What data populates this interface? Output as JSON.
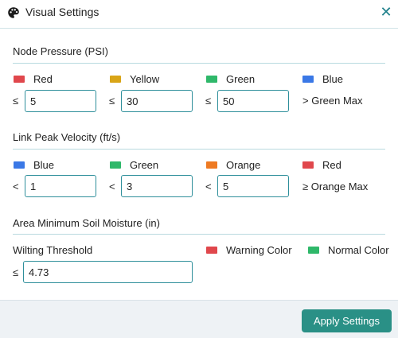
{
  "header": {
    "title": "Visual Settings",
    "icon": "palette-icon",
    "close_icon": "close-icon",
    "close_glyph": "✕"
  },
  "node_pressure": {
    "title": "Node Pressure (PSI)",
    "items": [
      {
        "label": "Red",
        "color": "#e0474c",
        "operator": "≤",
        "value": "5"
      },
      {
        "label": "Yellow",
        "color": "#d9a517",
        "operator": "≤",
        "value": "30"
      },
      {
        "label": "Green",
        "color": "#2fb86a",
        "operator": "≤",
        "value": "50"
      },
      {
        "label": "Blue",
        "color": "#3a78e6",
        "note": "> Green Max"
      }
    ]
  },
  "link_velocity": {
    "title": "Link Peak Velocity (ft/s)",
    "items": [
      {
        "label": "Blue",
        "color": "#3a78e6",
        "operator": "<",
        "value": "1"
      },
      {
        "label": "Green",
        "color": "#2fb86a",
        "operator": "<",
        "value": "3"
      },
      {
        "label": "Orange",
        "color": "#ee7a22",
        "operator": "<",
        "value": "5"
      },
      {
        "label": "Red",
        "color": "#e0474c",
        "note": "≥ Orange Max"
      }
    ]
  },
  "soil_moisture": {
    "title": "Area Minimum Soil Moisture (in)",
    "threshold_label": "Wilting Threshold",
    "operator": "≤",
    "value": "4.73",
    "warning": {
      "label": "Warning Color",
      "color": "#e0474c"
    },
    "normal": {
      "label": "Normal Color",
      "color": "#2fb86a"
    }
  },
  "footer": {
    "apply_label": "Apply Settings",
    "button_color": "#2a9086"
  }
}
